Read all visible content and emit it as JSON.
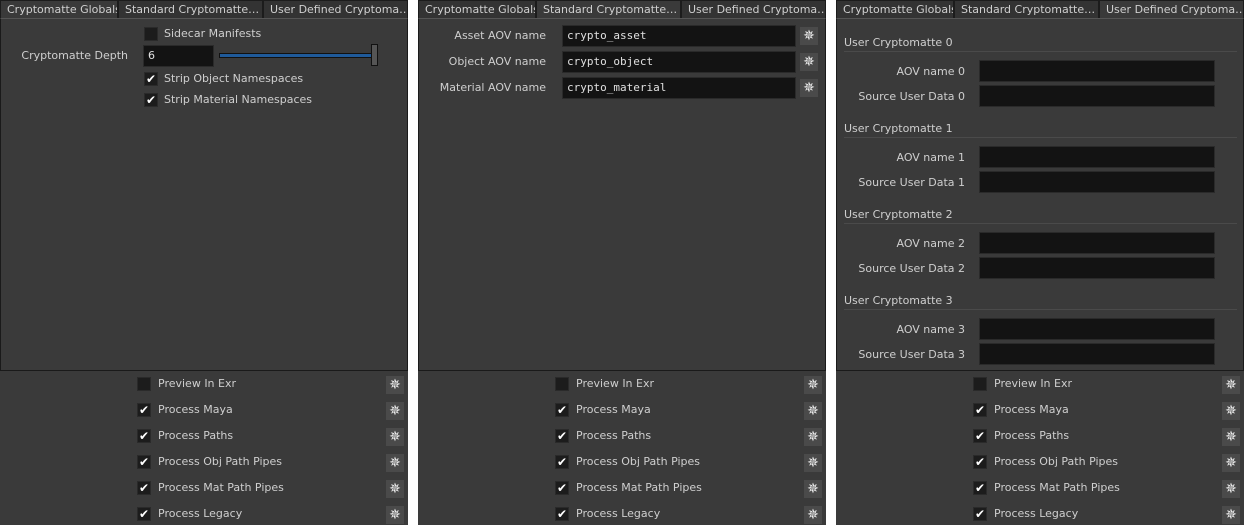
{
  "tabs": [
    "Cryptomatte Globals",
    "Standard Cryptomatte…",
    "User Defined Cryptoma…"
  ],
  "globals": {
    "sidecar_label": "Sidecar Manifests",
    "sidecar_checked": false,
    "depth_label": "Cryptomatte Depth",
    "depth_value": "6",
    "depth_slider_fraction": 1.0,
    "strip_object_label": "Strip Object Namespaces",
    "strip_object_checked": true,
    "strip_material_label": "Strip Material Namespaces",
    "strip_material_checked": true
  },
  "standard": {
    "fields": [
      {
        "label": "Asset AOV name",
        "value": "crypto_asset"
      },
      {
        "label": "Object AOV name",
        "value": "crypto_object"
      },
      {
        "label": "Material AOV name",
        "value": "crypto_material"
      }
    ]
  },
  "user_defined": {
    "sections": [
      {
        "title": "User Cryptomatte 0",
        "aov_label": "AOV name 0",
        "aov_value": "",
        "source_label": "Source User Data 0",
        "source_value": ""
      },
      {
        "title": "User Cryptomatte 1",
        "aov_label": "AOV name 1",
        "aov_value": "",
        "source_label": "Source User Data 1",
        "source_value": ""
      },
      {
        "title": "User Cryptomatte 2",
        "aov_label": "AOV name 2",
        "aov_value": "",
        "source_label": "Source User Data 2",
        "source_value": ""
      },
      {
        "title": "User Cryptomatte 3",
        "aov_label": "AOV name 3",
        "aov_value": "",
        "source_label": "Source User Data 3",
        "source_value": ""
      }
    ]
  },
  "options": [
    {
      "label": "Preview In Exr",
      "checked": false
    },
    {
      "label": "Process Maya",
      "checked": true
    },
    {
      "label": "Process Paths",
      "checked": true
    },
    {
      "label": "Process Obj Path Pipes",
      "checked": true
    },
    {
      "label": "Process Mat Path Pipes",
      "checked": true
    },
    {
      "label": "Process Legacy",
      "checked": true
    }
  ],
  "icons": {
    "check": "✔",
    "gear": "✵"
  }
}
